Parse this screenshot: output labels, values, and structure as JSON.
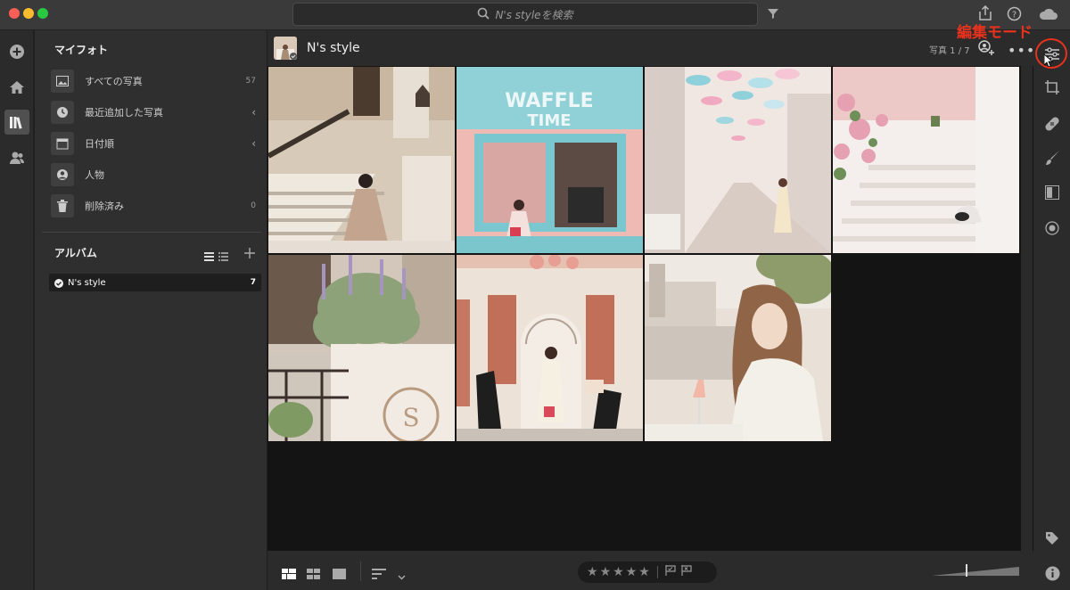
{
  "titlebar": {
    "search_placeholder": "N's styleを検索"
  },
  "sidebar": {
    "my_photos_title": "マイフォト",
    "items": [
      {
        "label": "すべての写真",
        "count": "57",
        "icon": "image-icon"
      },
      {
        "label": "最近追加した写真",
        "count": "",
        "icon": "clock-icon"
      },
      {
        "label": "日付順",
        "count": "",
        "icon": "calendar-icon"
      },
      {
        "label": "人物",
        "count": "",
        "icon": "person-icon"
      },
      {
        "label": "削除済み",
        "count": "0",
        "icon": "trash-icon"
      }
    ],
    "albums_title": "アルバム",
    "albums": [
      {
        "label": "N's style",
        "count": "7"
      }
    ]
  },
  "main": {
    "album_title": "N's style",
    "photo_count": "写真 1 / 7",
    "photos": [
      {
        "name": "woman-on-palace-stairs",
        "colors": [
          "#cdbfae",
          "#e8e2d8",
          "#8a7766"
        ]
      },
      {
        "name": "waffle-time-shop",
        "colors": [
          "#79c7cf",
          "#f1c7c5",
          "#5b3a34"
        ]
      },
      {
        "name": "umbrella-street",
        "colors": [
          "#e9d5d2",
          "#b7d9e2",
          "#f0e8e6"
        ]
      },
      {
        "name": "white-stairs-pink-flowers",
        "colors": [
          "#f3ecea",
          "#e6a9b4",
          "#d5cdc9"
        ]
      },
      {
        "name": "lavender-planter",
        "colors": [
          "#8fa07a",
          "#efe9e2",
          "#b7a088"
        ]
      },
      {
        "name": "restaurant-facade",
        "colors": [
          "#e9ddd1",
          "#c0735e",
          "#3a3330"
        ]
      },
      {
        "name": "woman-with-drink-lake",
        "colors": [
          "#e6dcd2",
          "#9a7457",
          "#cfc7bd"
        ]
      }
    ]
  },
  "annotation": {
    "label": "編集モード"
  }
}
